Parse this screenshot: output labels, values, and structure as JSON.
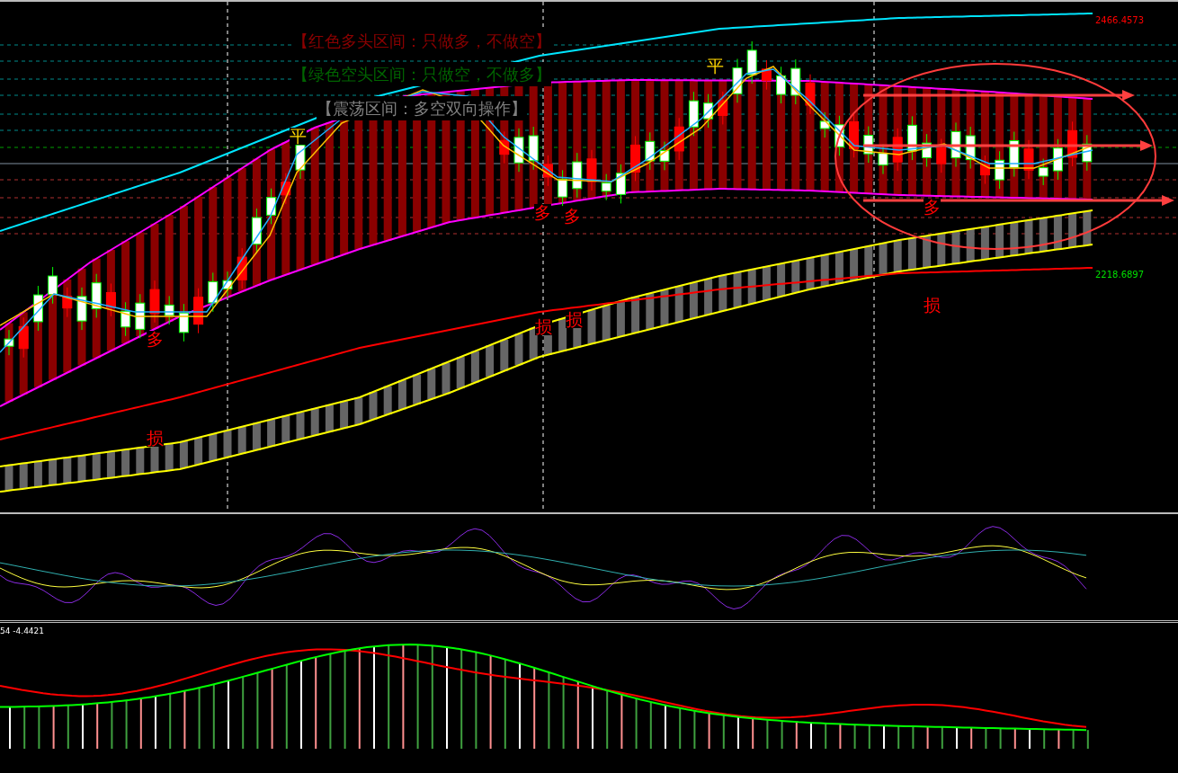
{
  "legend": [
    {
      "text": "【红色多头区间：只做多，不做空】",
      "color": "#8b0000"
    },
    {
      "text": "【绿色空头区间：只做空，不做多】",
      "color": "#006400"
    },
    {
      "text": "【震荡区间：多空双向操作】",
      "color": "#808080"
    }
  ],
  "price_labels": [
    {
      "text": "2466.4573",
      "color": "#ff0000"
    },
    {
      "text": "2218.6897",
      "color": "#00e000"
    }
  ],
  "markers": [
    {
      "text": "平",
      "color": "#ffd700"
    },
    {
      "text": "平",
      "color": "#ffd700"
    },
    {
      "text": "多",
      "color": "#ff0000"
    },
    {
      "text": "多",
      "color": "#ff0000"
    },
    {
      "text": "多",
      "color": "#ff0000"
    },
    {
      "text": "多",
      "color": "#ff0000"
    },
    {
      "text": "损",
      "color": "#ff0000"
    },
    {
      "text": "损",
      "color": "#ff0000"
    },
    {
      "text": "损",
      "color": "#ff0000"
    },
    {
      "text": "损",
      "color": "#ff0000"
    }
  ],
  "macd_pane": {
    "label": "54 -4.4421"
  }
}
